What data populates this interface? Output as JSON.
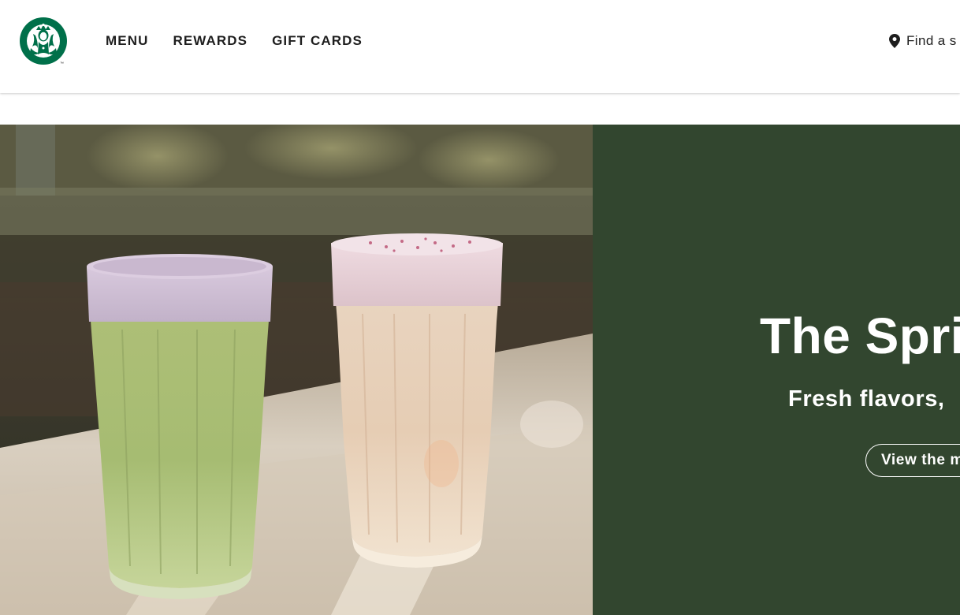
{
  "header": {
    "logo_alt": "Starbucks",
    "nav": [
      {
        "label": "MENU"
      },
      {
        "label": "REWARDS"
      },
      {
        "label": "GIFT CARDS"
      }
    ],
    "find_store": {
      "label": "Find a s",
      "icon": "location-pin-icon"
    }
  },
  "hero": {
    "title": "The Spri",
    "subtitle": "Fresh flavors,",
    "cta_label": "View the m",
    "panel_color": "#32462f",
    "image_description_icon": "iced-drinks-photo"
  },
  "colors": {
    "brand_green": "#00704a",
    "panel_green": "#32462f",
    "nav_text": "#1e1e1e"
  }
}
